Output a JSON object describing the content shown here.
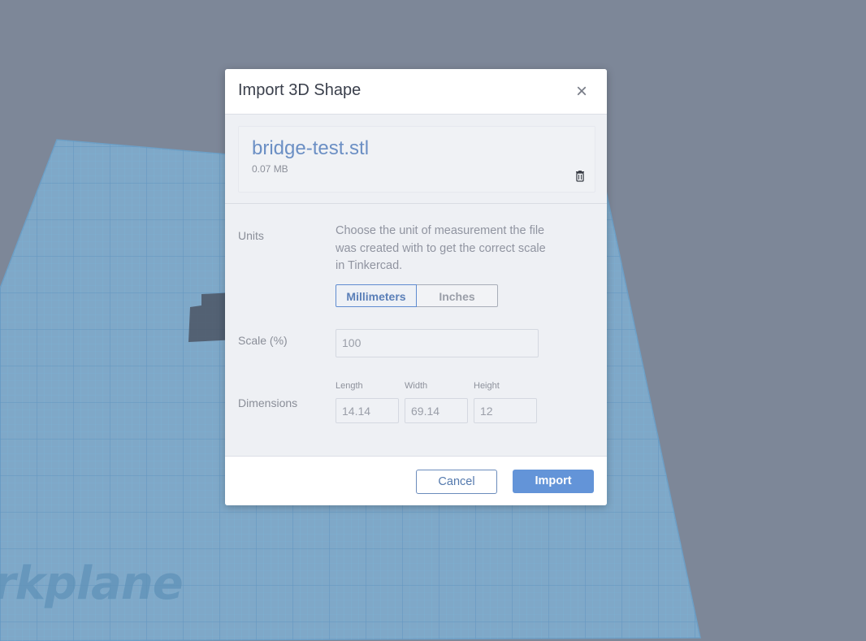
{
  "workplane": {
    "label": "rkplane"
  },
  "dialog": {
    "title": "Import 3D Shape",
    "file": {
      "name": "bridge-test.stl",
      "size": "0.07 MB"
    },
    "units": {
      "label": "Units",
      "description": "Choose the unit of measurement the file was created with to get the correct scale in Tinkercad.",
      "options": [
        "Millimeters",
        "Inches"
      ],
      "selected": "Millimeters"
    },
    "scale": {
      "label": "Scale (%)",
      "value": "100"
    },
    "dimensions": {
      "label": "Dimensions",
      "length_label": "Length",
      "length": "14.14",
      "width_label": "Width",
      "width": "69.14",
      "height_label": "Height",
      "height": "12"
    },
    "cancel_label": "Cancel",
    "import_label": "Import"
  },
  "colors": {
    "accent": "#6394d8",
    "grid": "#6aa6cf",
    "background": "#7d8798"
  },
  "icons": {
    "close": "close-icon",
    "delete": "trash-icon"
  }
}
